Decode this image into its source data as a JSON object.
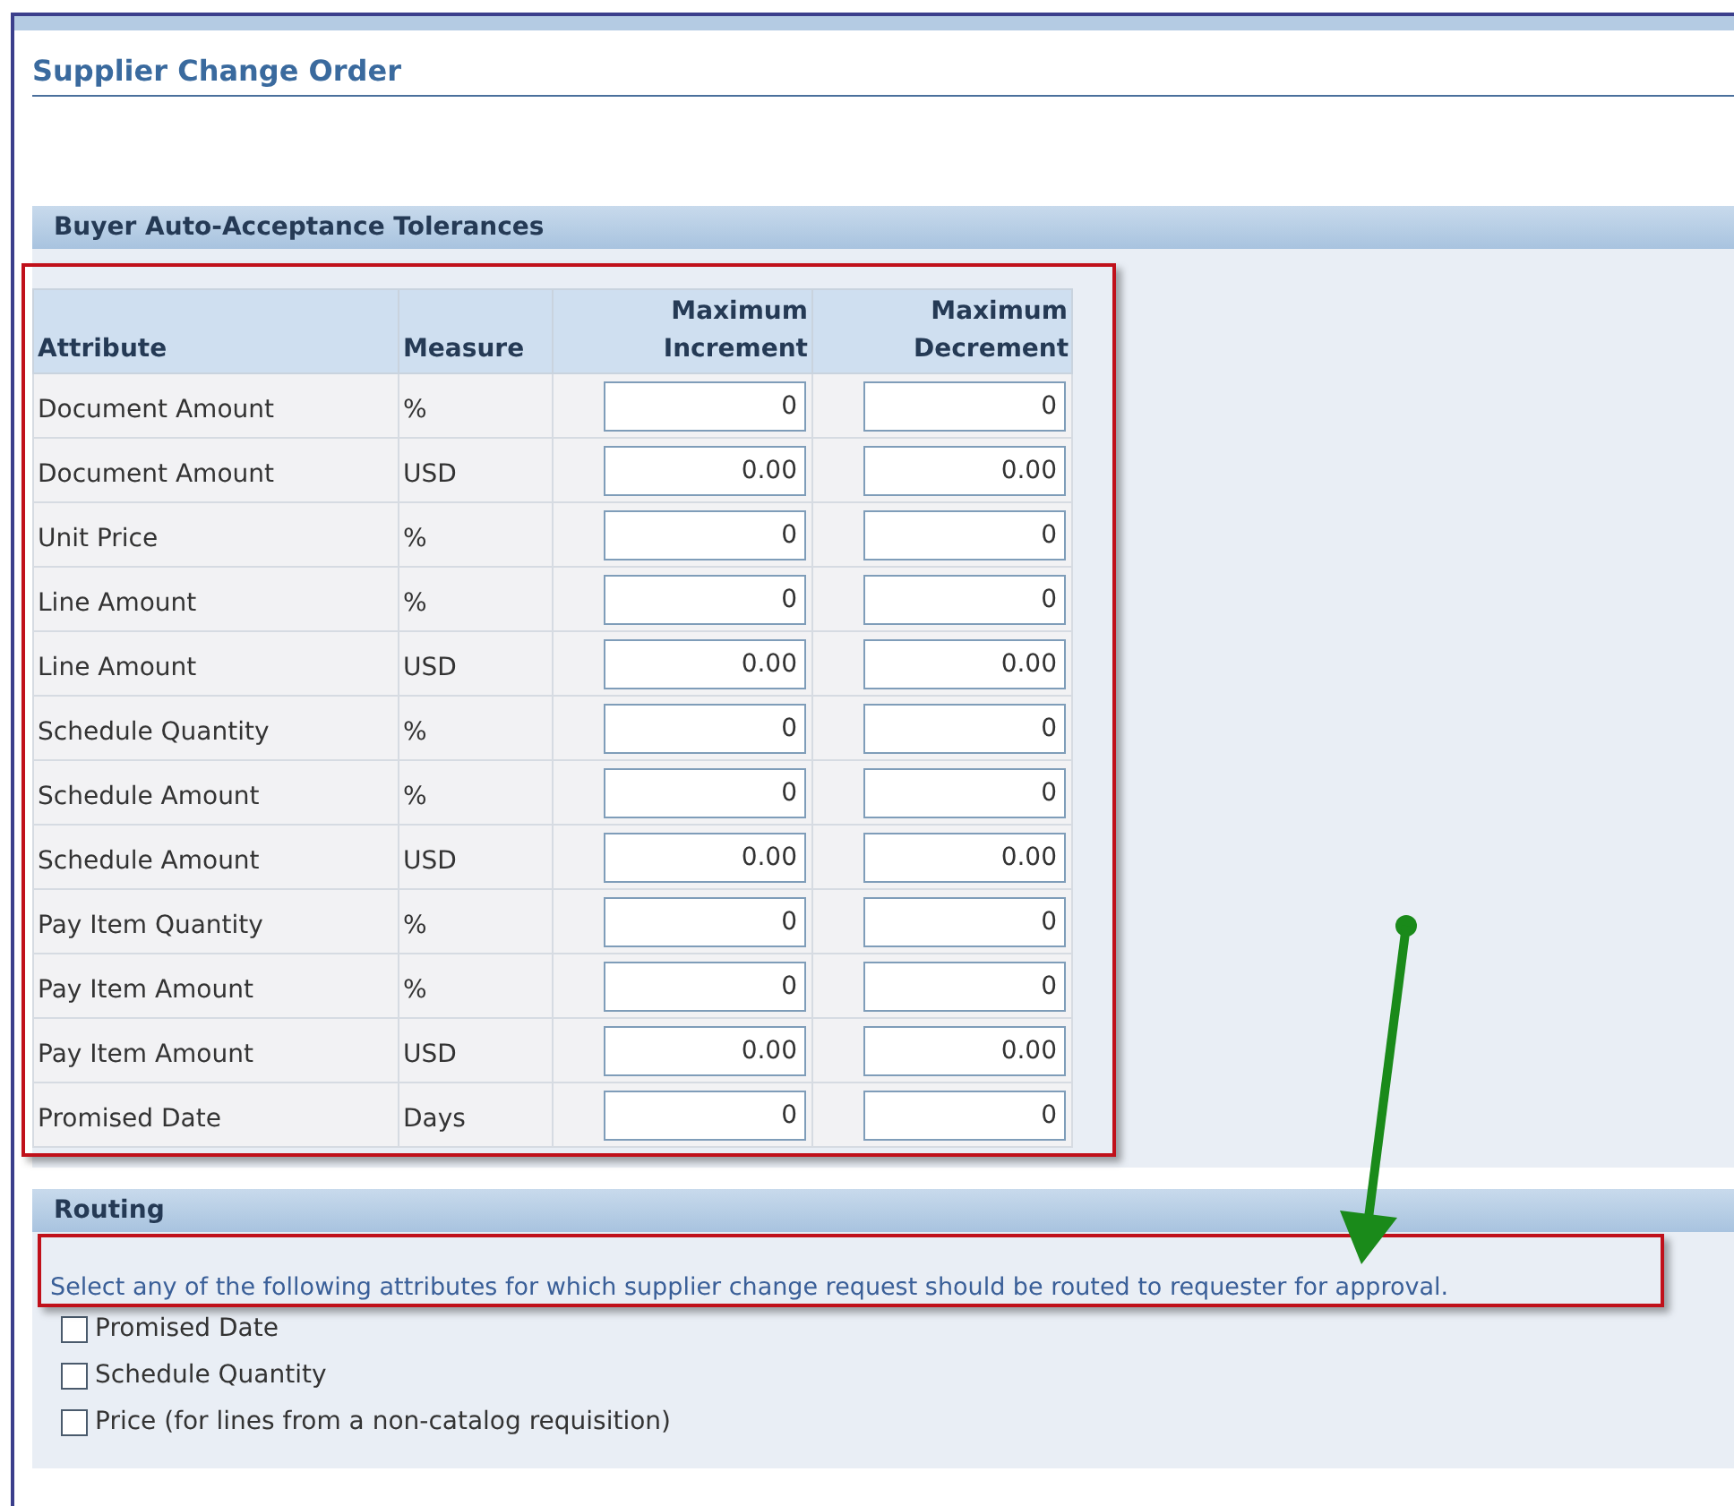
{
  "page_title": "Supplier Change Order",
  "tolerances": {
    "header": "Buyer Auto-Acceptance Tolerances",
    "columns": [
      "Attribute",
      "Measure",
      "Maximum Increment",
      "Maximum Decrement"
    ],
    "rows": [
      {
        "attribute": "Document Amount",
        "measure": "%",
        "increment": "0",
        "decrement": "0"
      },
      {
        "attribute": "Document Amount",
        "measure": "USD",
        "increment": "0.00",
        "decrement": "0.00"
      },
      {
        "attribute": "Unit Price",
        "measure": "%",
        "increment": "0",
        "decrement": "0"
      },
      {
        "attribute": "Line Amount",
        "measure": "%",
        "increment": "0",
        "decrement": "0"
      },
      {
        "attribute": "Line Amount",
        "measure": "USD",
        "increment": "0.00",
        "decrement": "0.00"
      },
      {
        "attribute": "Schedule Quantity",
        "measure": "%",
        "increment": "0",
        "decrement": "0"
      },
      {
        "attribute": "Schedule Amount",
        "measure": "%",
        "increment": "0",
        "decrement": "0"
      },
      {
        "attribute": "Schedule Amount",
        "measure": "USD",
        "increment": "0.00",
        "decrement": "0.00"
      },
      {
        "attribute": "Pay Item Quantity",
        "measure": "%",
        "increment": "0",
        "decrement": "0"
      },
      {
        "attribute": "Pay Item Amount",
        "measure": "%",
        "increment": "0",
        "decrement": "0"
      },
      {
        "attribute": "Pay Item Amount",
        "measure": "USD",
        "increment": "0.00",
        "decrement": "0.00"
      },
      {
        "attribute": "Promised Date",
        "measure": "Days",
        "increment": "0",
        "decrement": "0"
      }
    ]
  },
  "routing": {
    "header": "Routing",
    "instruction": "Select any of the following attributes for which supplier change request should be routed to requester for approval.",
    "options": [
      {
        "label": "Promised Date",
        "checked": false
      },
      {
        "label": "Schedule Quantity",
        "checked": false
      },
      {
        "label": "Price (for lines from a non-catalog requisition)",
        "checked": false
      }
    ]
  }
}
